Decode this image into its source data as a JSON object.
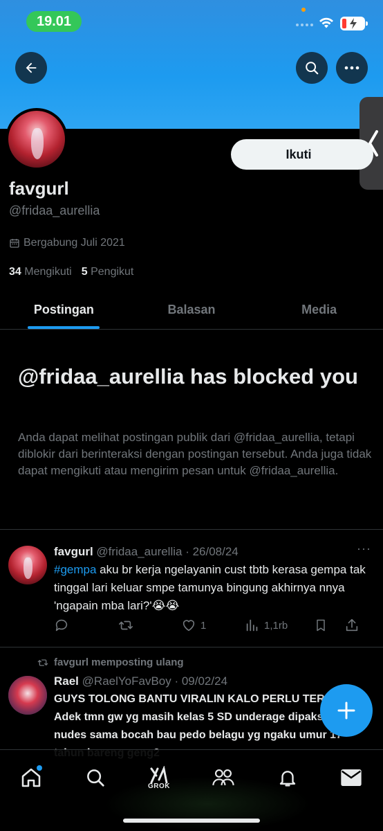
{
  "status_bar": {
    "time": "19.01"
  },
  "profile": {
    "display_name": "favgurl",
    "handle": "@fridaa_aurellia",
    "joined": "Bergabung Juli 2021",
    "following_count": "34",
    "following_label": "Mengikuti",
    "followers_count": "5",
    "followers_label": "Pengikut",
    "follow_button": "Ikuti"
  },
  "tabs": [
    {
      "label": "Postingan",
      "active": true
    },
    {
      "label": "Balasan",
      "active": false
    },
    {
      "label": "Media",
      "active": false
    }
  ],
  "blocked": {
    "title": "@fridaa_aurellia has blocked you",
    "description": "Anda dapat melihat postingan publik dari @fridaa_aurellia, tetapi diblokir dari berinteraksi dengan postingan tersebut. Anda juga tidak dapat mengikuti atau mengirim pesan untuk @fridaa_aurellia."
  },
  "posts": [
    {
      "name": "favgurl",
      "meta": "@fridaa_aurellia · 26/08/24",
      "hashtag": "#gempa",
      "text": " aku br kerja ngelayanin cust tbtb kerasa gempa tak tinggal lari keluar smpe tamunya bingung akhirnya nnya 'ngapain mba lari?'😭😭",
      "likes": "1",
      "views": "1,1rb"
    },
    {
      "repost_by": "favgurl memposting ulang",
      "name": "Rael",
      "meta": "@RaelYoFavBoy · 09/02/24",
      "text": "GUYS TOLONG BANTU VIRALIN KALO PERLU TEROR AJA. Adek tmn gw yg masih kelas 5 SD underage dipaksa pap2 nudes sama bocah bau pedo belagu yg ngaku umur 17 tahun bareng geng2"
    }
  ],
  "bottom_nav": {
    "grok_label": "GROK"
  },
  "colors": {
    "accent": "#1d9bf0",
    "background": "#000000",
    "muted": "#71767b"
  },
  "icons": [
    "back-arrow-icon",
    "search-icon",
    "more-icon",
    "calendar-icon",
    "reply-icon",
    "repost-icon",
    "like-icon",
    "views-icon",
    "bookmark-icon",
    "share-icon",
    "plus-icon",
    "home-icon",
    "grok-icon",
    "communities-icon",
    "bell-icon",
    "mail-icon"
  ]
}
